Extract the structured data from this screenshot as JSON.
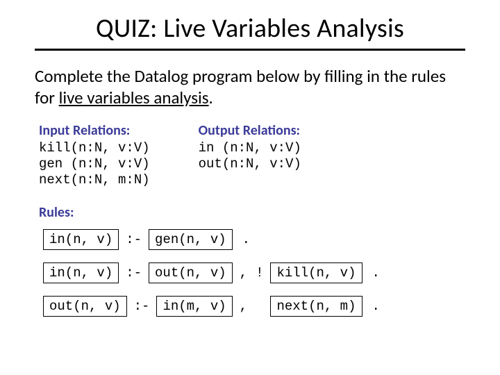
{
  "title": "QUIZ: Live Variables Analysis",
  "instruction_pre": "Complete the Datalog program below by filling in the rules for ",
  "instruction_ul": "live variables analysis",
  "instruction_post": ".",
  "input_relations": {
    "heading": "Input Relations:",
    "body": "kill(n:N, v:V)\ngen (n:N, v:V)\nnext(n:N, m:N)"
  },
  "output_relations": {
    "heading": "Output Relations:",
    "body": "in (n:N, v:V)\nout(n:N, v:V)"
  },
  "rules_heading": "Rules:",
  "rules": [
    {
      "head": "in(n, v)",
      "deriv": ":-",
      "b1": "gen(n, v)",
      "post": "."
    },
    {
      "head": "in(n, v)",
      "deriv": ":-",
      "b1": "out(n, v)",
      "sep1": ",",
      "neg": "!",
      "b2": "kill(n, v)",
      "post": "."
    },
    {
      "head": "out(n, v)",
      "deriv": ":-",
      "b1": "in(m, v)",
      "sep1": ",",
      "b2": "next(n, m)",
      "post": "."
    }
  ]
}
